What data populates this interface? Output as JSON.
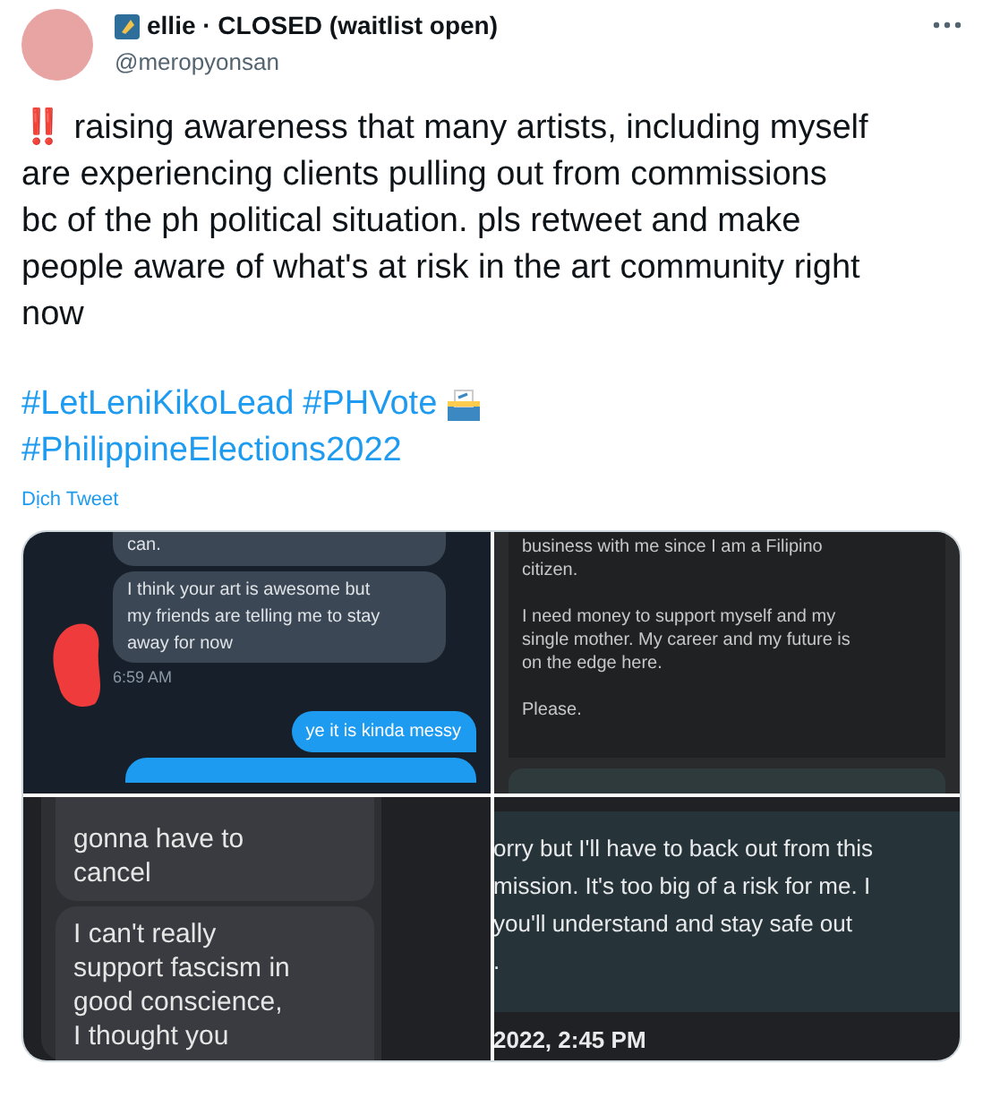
{
  "author": {
    "name": "ellie · CLOSED (waitlist open)",
    "handle": "@meropyonsan"
  },
  "tweet": {
    "alert": "‼️",
    "text": "raising awareness that many artists, including myself are experiencing clients pulling out from commissions bc of the ph political situation. pls retweet and make people aware of what's at risk in the art community right now",
    "hashtags": [
      "#LetLeniKikoLead",
      "#PHVote",
      "#PhilippineElections2022"
    ],
    "translate": "Dịch Tweet"
  },
  "images": [
    {
      "kind": "chat_blue",
      "bubbles": [
        {
          "lines": [
            "can."
          ]
        },
        {
          "lines": [
            "I think your art is awesome but",
            "my friends are telling me to stay",
            "away for now"
          ]
        }
      ],
      "time": "6:59 AM",
      "reply": "ye it is kinda messy"
    },
    {
      "kind": "chat_dark",
      "paragraphs": [
        [
          "business with me since I am a Filipino",
          "citizen."
        ],
        [
          "I need money to support myself and my",
          "single mother. My career and my future is",
          "on the edge here."
        ],
        [
          "Please."
        ]
      ]
    },
    {
      "kind": "chat_grey",
      "bubbles": [
        {
          "lines": [
            "gonna have to",
            "cancel"
          ]
        },
        {
          "lines": [
            "I can't really",
            "support fascism in",
            "good conscience,",
            "I thought you"
          ]
        }
      ]
    },
    {
      "kind": "chat_teal",
      "lines": [
        "orry but I'll have to back out from this",
        "mission. It's too big of a risk for me. I",
        "you'll understand and stay safe out",
        "."
      ],
      "time": "2022, 2:45 PM"
    }
  ]
}
